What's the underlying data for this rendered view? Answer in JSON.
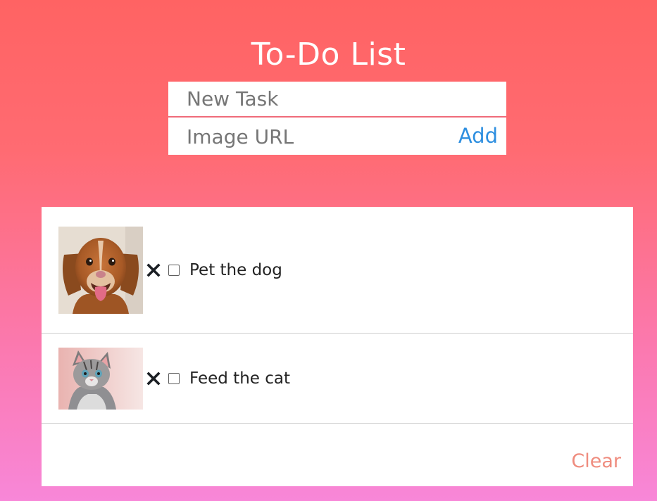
{
  "app": {
    "title": "To-Do List"
  },
  "form": {
    "task_placeholder": "New Task",
    "task_value": "",
    "image_placeholder": "Image URL",
    "image_value": "",
    "add_label": "Add"
  },
  "tasks": [
    {
      "text": "Pet the dog",
      "image": "dog-photo",
      "done": false
    },
    {
      "text": "Feed the cat",
      "image": "cat-photo",
      "done": false
    }
  ],
  "footer": {
    "clear_label": "Clear"
  },
  "colors": {
    "gradient_top": "#ff6363",
    "gradient_bottom": "#f887d8",
    "add_button": "#2e8fe0",
    "clear_button": "#ef8c7e",
    "input_divider": "#ef6b7a"
  },
  "icons": {
    "delete": "close-icon",
    "checkbox": "checkbox-icon"
  }
}
